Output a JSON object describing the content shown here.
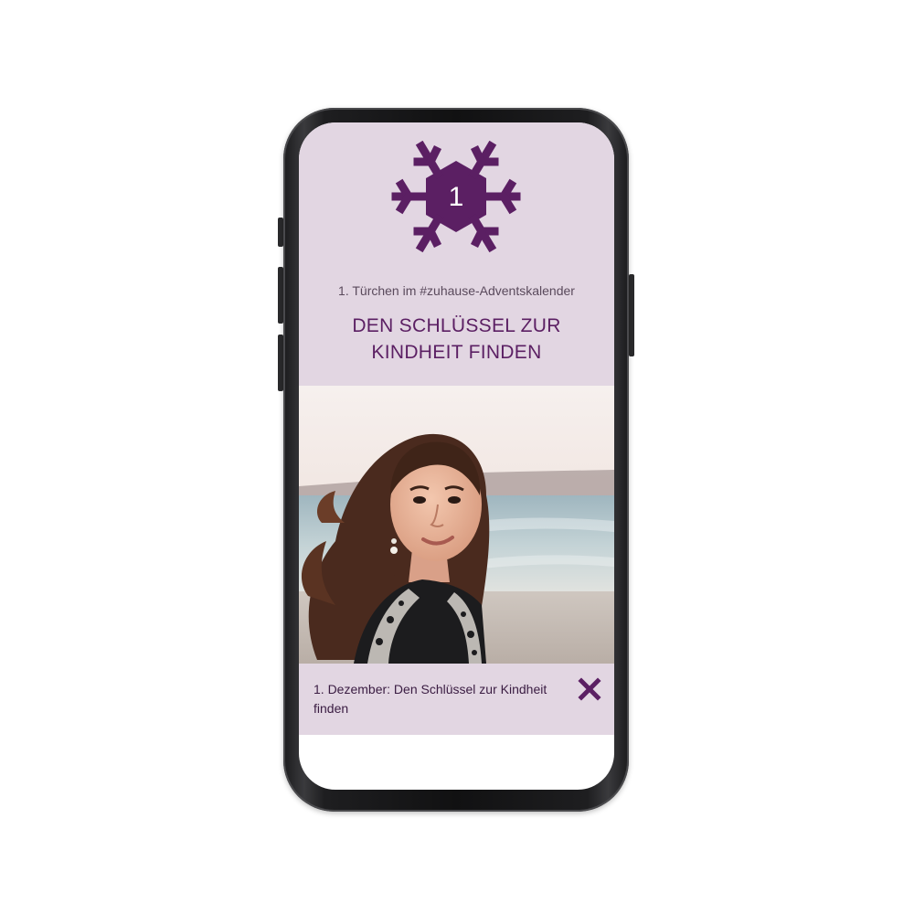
{
  "calendar": {
    "door_number": "1",
    "subtitle": "1. Türchen im #zuhause-Adventskalender",
    "title_line1": "DEN SCHLÜSSEL ZUR",
    "title_line2": "KINDHEIT FINDEN"
  },
  "caption": {
    "text": "1. Dezember: Den Schlüssel zur Kindheit finden"
  },
  "icons": {
    "header": "snowflake-icon",
    "close": "close-icon"
  },
  "colors": {
    "accent": "#5b1f63",
    "header_bg": "#e2d6e2",
    "caption_bg": "#e2d6e2"
  }
}
